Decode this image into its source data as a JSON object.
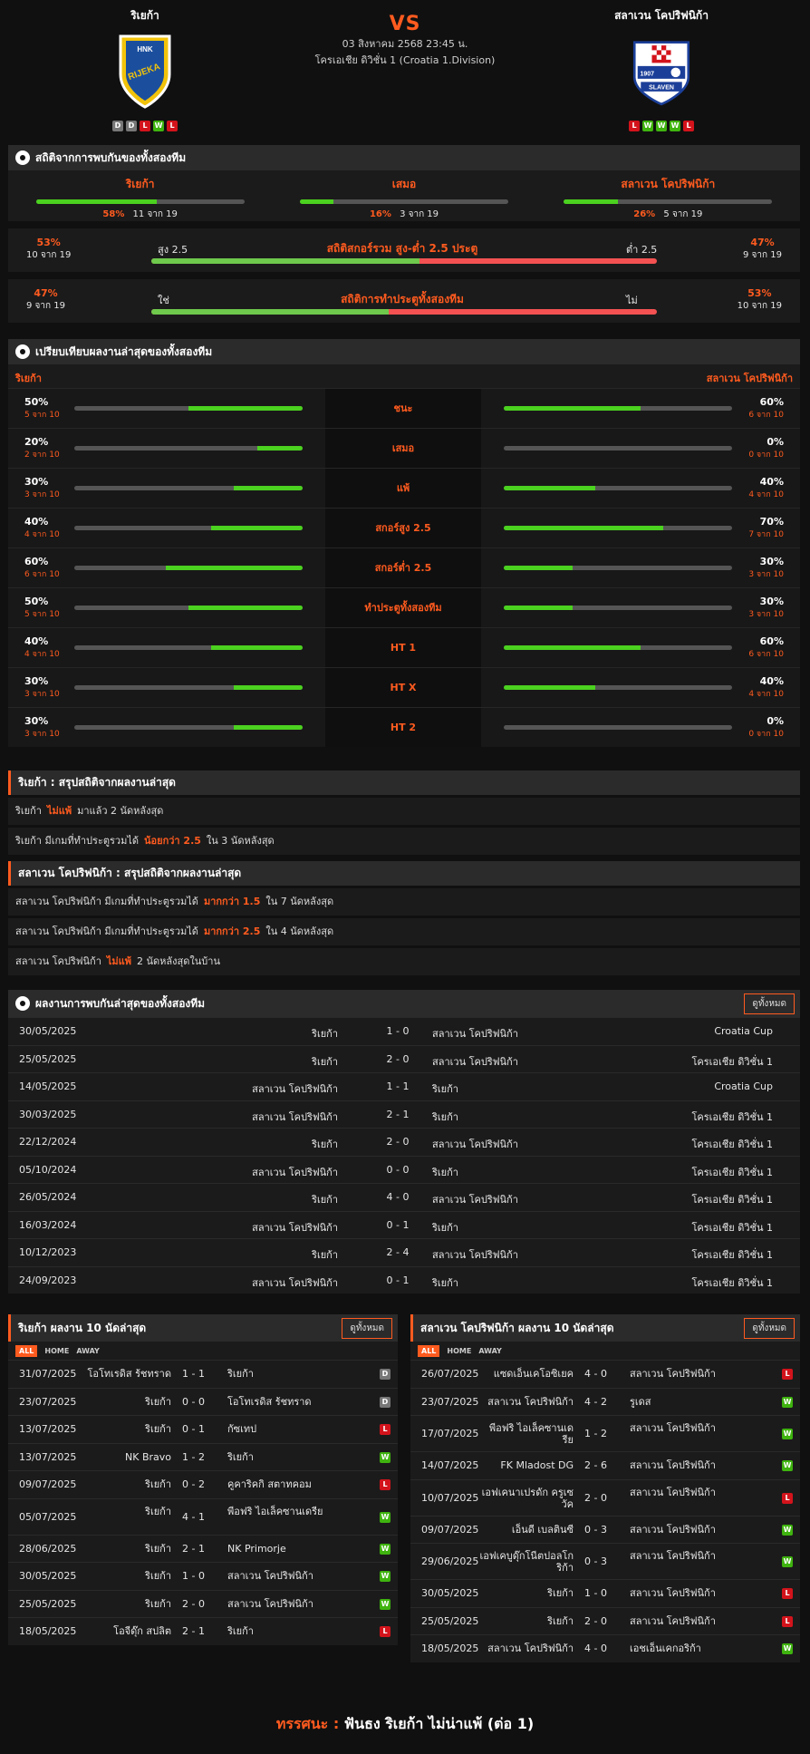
{
  "header": {
    "home_name": "ริเยก้า",
    "away_name": "สลาเวน โคปริฟนิก้า",
    "vs": "VS",
    "datetime": "03 สิงหาคม 2568 23:45 น.",
    "league": "โครเอเชีย ดิวิชั่น 1 (Croatia 1.Division)",
    "home_logo_text": "HNK RIJEKA",
    "away_logo_text": "SLAVEN",
    "away_logo_year": "1907",
    "home_form": [
      "D",
      "D",
      "L",
      "W",
      "L"
    ],
    "away_form": [
      "L",
      "W",
      "W",
      "W",
      "L"
    ]
  },
  "h2h_stats": {
    "title": "สถิติจากการพบกันของทั้งสองทีม",
    "cols": [
      {
        "label": "ริเยก้า",
        "pct": "58%",
        "count": "11 จาก 19",
        "fill": 0.58
      },
      {
        "label": "เสมอ",
        "pct": "16%",
        "count": "3 จาก 19",
        "fill": 0.16
      },
      {
        "label": "สลาเวน โคปริฟนิก้า",
        "pct": "26%",
        "count": "5 จาก 19",
        "fill": 0.26
      }
    ],
    "ou": {
      "title": "สถิติสกอร์รวม สูง-ต่ำ 2.5 ประตู",
      "left_label": "สูง 2.5",
      "right_label": "ต่ำ 2.5",
      "left_pct": "53%",
      "left_count": "10 จาก 19",
      "right_pct": "47%",
      "right_count": "9 จาก 19",
      "fill": 0.53
    },
    "btts": {
      "title": "สถิติการทำประตูทั้งสองทีม",
      "left_label": "ใช่",
      "right_label": "ไม่",
      "left_pct": "47%",
      "left_count": "9 จาก 19",
      "right_pct": "53%",
      "right_count": "10 จาก 19",
      "fill": 0.47
    }
  },
  "compare": {
    "title": "เปรียบเทียบผลงานล่าสุดของทั้งสองทีม",
    "home": "ริเยก้า",
    "away": "สลาเวน โคปริฟนิก้า",
    "rows": [
      {
        "label": "ชนะ",
        "hp": "50%",
        "hc": "5 จาก 10",
        "hf": 0.5,
        "ap": "60%",
        "ac": "6 จาก 10",
        "af": 0.6
      },
      {
        "label": "เสมอ",
        "hp": "20%",
        "hc": "2 จาก 10",
        "hf": 0.2,
        "ap": "0%",
        "ac": "0 จาก 10",
        "af": 0
      },
      {
        "label": "แพ้",
        "hp": "30%",
        "hc": "3 จาก 10",
        "hf": 0.3,
        "ap": "40%",
        "ac": "4 จาก 10",
        "af": 0.4
      },
      {
        "label": "สกอร์สูง 2.5",
        "hp": "40%",
        "hc": "4 จาก 10",
        "hf": 0.4,
        "ap": "70%",
        "ac": "7 จาก 10",
        "af": 0.7
      },
      {
        "label": "สกอร์ต่ำ 2.5",
        "hp": "60%",
        "hc": "6 จาก 10",
        "hf": 0.6,
        "ap": "30%",
        "ac": "3 จาก 10",
        "af": 0.3
      },
      {
        "label": "ทำประตูทั้งสองทีม",
        "hp": "50%",
        "hc": "5 จาก 10",
        "hf": 0.5,
        "ap": "30%",
        "ac": "3 จาก 10",
        "af": 0.3
      },
      {
        "label": "HT 1",
        "hp": "40%",
        "hc": "4 จาก 10",
        "hf": 0.4,
        "ap": "60%",
        "ac": "6 จาก 10",
        "af": 0.6
      },
      {
        "label": "HT X",
        "hp": "30%",
        "hc": "3 จาก 10",
        "hf": 0.3,
        "ap": "40%",
        "ac": "4 จาก 10",
        "af": 0.4
      },
      {
        "label": "HT 2",
        "hp": "30%",
        "hc": "3 จาก 10",
        "hf": 0.3,
        "ap": "0%",
        "ac": "0 จาก 10",
        "af": 0
      }
    ]
  },
  "home_summary": {
    "title": "ริเยก้า : สรุปสถิติจากผลงานล่าสุด",
    "lines": [
      {
        "a": "ริเยก้า",
        "hl": "ไม่แพ้",
        "b": "มาแล้ว 2 นัดหลังสุด"
      },
      {
        "a": "ริเยก้า มีเกมที่ทำประตูรวมได้",
        "hl": "น้อยกว่า 2.5",
        "b": "ใน 3 นัดหลังสุด"
      }
    ]
  },
  "away_summary": {
    "title": "สลาเวน โคปริฟนิก้า : สรุปสถิติจากผลงานล่าสุด",
    "lines": [
      {
        "a": "สลาเวน โคปริฟนิก้า มีเกมที่ทำประตูรวมได้",
        "hl": "มากกว่า 1.5",
        "b": "ใน 7 นัดหลังสุด"
      },
      {
        "a": "สลาเวน โคปริฟนิก้า มีเกมที่ทำประตูรวมได้",
        "hl": "มากกว่า 2.5",
        "b": "ใน 4 นัดหลังสุด"
      },
      {
        "a": "สลาเวน โคปริฟนิก้า",
        "hl": "ไม่แพ้",
        "b": "2 นัดหลังสุดในบ้าน"
      }
    ]
  },
  "h2h_list": {
    "title": "ผลงานการพบกันล่าสุดของทั้งสองทีม",
    "see_all": "ดูทั้งหมด",
    "rows": [
      {
        "date": "30/05/2025",
        "home": "ริเยก้า",
        "score": "1 - 0",
        "away": "สลาเวน โคปริฟนิก้า",
        "comp": "Croatia Cup"
      },
      {
        "date": "25/05/2025",
        "home": "ริเยก้า",
        "score": "2 - 0",
        "away": "สลาเวน โคปริฟนิก้า",
        "comp": "โครเอเชีย ดิวิชั่น 1"
      },
      {
        "date": "14/05/2025",
        "home": "สลาเวน โคปริฟนิก้า",
        "score": "1 - 1",
        "away": "ริเยก้า",
        "comp": "Croatia Cup"
      },
      {
        "date": "30/03/2025",
        "home": "สลาเวน โคปริฟนิก้า",
        "score": "2 - 1",
        "away": "ริเยก้า",
        "comp": "โครเอเชีย ดิวิชั่น 1"
      },
      {
        "date": "22/12/2024",
        "home": "ริเยก้า",
        "score": "2 - 0",
        "away": "สลาเวน โคปริฟนิก้า",
        "comp": "โครเอเชีย ดิวิชั่น 1"
      },
      {
        "date": "05/10/2024",
        "home": "สลาเวน โคปริฟนิก้า",
        "score": "0 - 0",
        "away": "ริเยก้า",
        "comp": "โครเอเชีย ดิวิชั่น 1"
      },
      {
        "date": "26/05/2024",
        "home": "ริเยก้า",
        "score": "4 - 0",
        "away": "สลาเวน โคปริฟนิก้า",
        "comp": "โครเอเชีย ดิวิชั่น 1"
      },
      {
        "date": "16/03/2024",
        "home": "สลาเวน โคปริฟนิก้า",
        "score": "0 - 1",
        "away": "ริเยก้า",
        "comp": "โครเอเชีย ดิวิชั่น 1"
      },
      {
        "date": "10/12/2023",
        "home": "ริเยก้า",
        "score": "2 - 4",
        "away": "สลาเวน โคปริฟนิก้า",
        "comp": "โครเอเชีย ดิวิชั่น 1"
      },
      {
        "date": "24/09/2023",
        "home": "สลาเวน โคปริฟนิก้า",
        "score": "0 - 1",
        "away": "ริเยก้า",
        "comp": "โครเอเชีย ดิวิชั่น 1"
      }
    ]
  },
  "tabs": [
    "ALL",
    "HOME",
    "AWAY"
  ],
  "home_last10": {
    "title": "ริเยก้า ผลงาน 10 นัดล่าสุด",
    "see_all": "ดูทั้งหมด",
    "rows": [
      {
        "date": "31/07/2025",
        "home": "โอโทเรดิส ร้ชทราด",
        "score": "1 - 1",
        "away": "ริเยก้า",
        "r": "D"
      },
      {
        "date": "23/07/2025",
        "home": "ริเยก้า",
        "score": "0 - 0",
        "away": "โอโทเรดิส ร้ชทราด",
        "r": "D"
      },
      {
        "date": "13/07/2025",
        "home": "ริเยก้า",
        "score": "0 - 1",
        "away": "กัซเทป",
        "r": "L"
      },
      {
        "date": "13/07/2025",
        "home": "NK Bravo",
        "score": "1 - 2",
        "away": "ริเยก้า",
        "r": "W"
      },
      {
        "date": "09/07/2025",
        "home": "ริเยก้า",
        "score": "0 - 2",
        "away": "คูคาริคกิ สตาทคอม",
        "r": "L"
      },
      {
        "date": "05/07/2025",
        "home": "ริเยก้า",
        "score": "4 - 1",
        "away": "พีอฟริ ไอเล็คซานเดรีย",
        "r": "W",
        "tall": true
      },
      {
        "date": "28/06/2025",
        "home": "ริเยก้า",
        "score": "2 - 1",
        "away": "NK Primorje",
        "r": "W"
      },
      {
        "date": "30/05/2025",
        "home": "ริเยก้า",
        "score": "1 - 0",
        "away": "สลาเวน โคปริฟนิก้า",
        "r": "W"
      },
      {
        "date": "25/05/2025",
        "home": "ริเยก้า",
        "score": "2 - 0",
        "away": "สลาเวน โคปริฟนิก้า",
        "r": "W"
      },
      {
        "date": "18/05/2025",
        "home": "โอจีดุ๊ก สปลิต",
        "score": "2 - 1",
        "away": "ริเยก้า",
        "r": "L"
      }
    ]
  },
  "away_last10": {
    "title": "สลาเวน โคปริฟนิก้า ผลงาน 10 นัดล่าสุด",
    "see_all": "ดูทั้งหมด",
    "rows": [
      {
        "date": "26/07/2025",
        "home": "แซดเอ็นเคโอซิเยค",
        "score": "4 - 0",
        "away": "สลาเวน โคปริฟนิก้า",
        "r": "L"
      },
      {
        "date": "23/07/2025",
        "home": "สลาเวน โคปริฟนิก้า",
        "score": "4 - 2",
        "away": "รูเดส",
        "r": "W"
      },
      {
        "date": "17/07/2025",
        "home": "พีอฟริ ไอเล็คซานเดรีย",
        "score": "1 - 2",
        "away": "สลาเวน โคปริฟนิก้า",
        "r": "W",
        "tall": true
      },
      {
        "date": "14/07/2025",
        "home": "FK Mladost DG",
        "score": "2 - 6",
        "away": "สลาเวน โคปริฟนิก้า",
        "r": "W"
      },
      {
        "date": "10/07/2025",
        "home": "เอฟเคนาเปรดัก ครูเซวัค",
        "score": "2 - 0",
        "away": "สลาเวน โคปริฟนิก้า",
        "r": "L",
        "tall": true
      },
      {
        "date": "09/07/2025",
        "home": "เอ็นดี เบลตินซี",
        "score": "0 - 3",
        "away": "สลาเวน โคปริฟนิก้า",
        "r": "W"
      },
      {
        "date": "29/06/2025",
        "home": "เอฟเคบูดุ๊กโนีตปอลโกริก้า",
        "score": "0 - 3",
        "away": "สลาเวน โคปริฟนิก้า",
        "r": "W",
        "tall": true
      },
      {
        "date": "30/05/2025",
        "home": "ริเยก้า",
        "score": "1 - 0",
        "away": "สลาเวน โคปริฟนิก้า",
        "r": "L"
      },
      {
        "date": "25/05/2025",
        "home": "ริเยก้า",
        "score": "2 - 0",
        "away": "สลาเวน โคปริฟนิก้า",
        "r": "L"
      },
      {
        "date": "18/05/2025",
        "home": "สลาเวน โคปริฟนิก้า",
        "score": "4 - 0",
        "away": "เอชเอ็นเคกอริก้า",
        "r": "W"
      }
    ]
  },
  "verdict": {
    "label": "ทรรศนะ :",
    "text": "ฟันธง ริเยก้า ไม่น่าแพ้ (ต่อ 1)"
  },
  "colors": {
    "accent": "#ff5b1f",
    "win": "#3fb30f",
    "loss": "#d3131b",
    "draw": "#777777",
    "bar_green": "#4bd11f"
  }
}
